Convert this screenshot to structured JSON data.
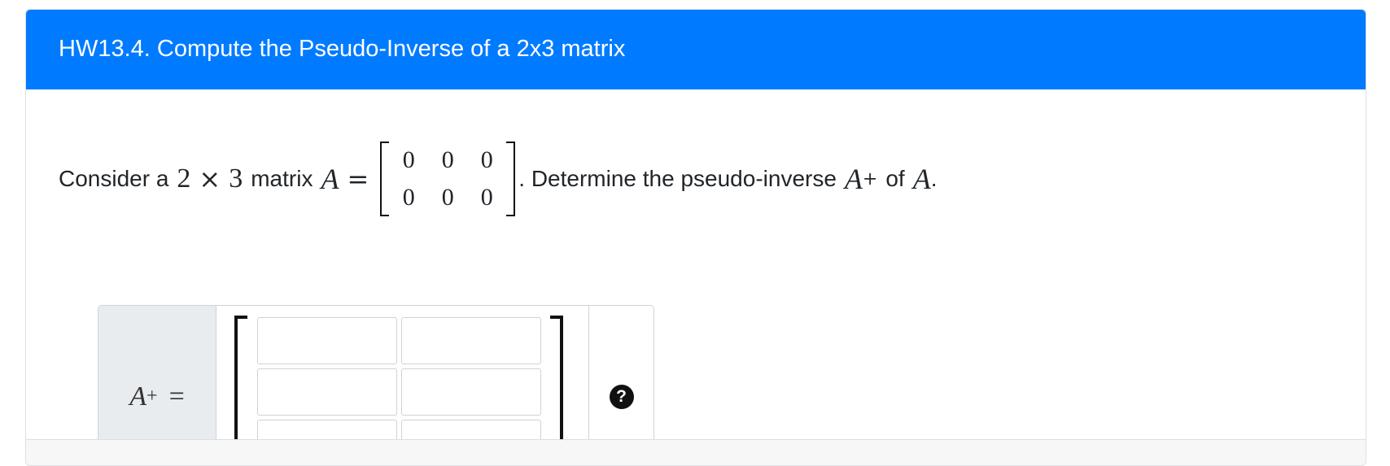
{
  "header": {
    "title": "HW13.4. Compute the Pseudo-Inverse of a 2x3 matrix"
  },
  "prompt": {
    "intro": "Consider a",
    "rows": "2",
    "times": "×",
    "cols": "3",
    "matrix_word": "matrix",
    "var": "A",
    "equals": "=",
    "matrix": [
      [
        "0",
        "0",
        "0"
      ],
      [
        "0",
        "0",
        "0"
      ]
    ],
    "after": ". Determine the pseudo-inverse",
    "pinv_var": "A",
    "plus": "+",
    "of": "of",
    "final_var": "A",
    "period": "."
  },
  "answer": {
    "label_var": "A",
    "label_sup": "+",
    "label_eq": "=",
    "cells": [
      "",
      "",
      "",
      "",
      "",
      ""
    ],
    "help_glyph": "?"
  }
}
